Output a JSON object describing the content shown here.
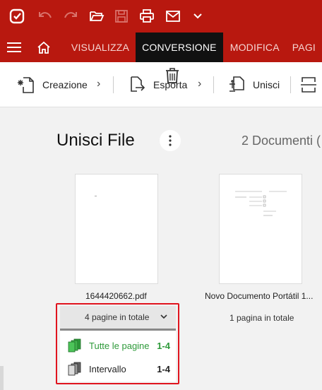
{
  "titlebar": {
    "icons": [
      "app-logo-icon",
      "undo-icon",
      "redo-icon",
      "open-folder-icon",
      "save-icon",
      "print-icon",
      "email-icon",
      "chevron-down-icon"
    ]
  },
  "menu": {
    "tabs": [
      {
        "label": "VISUALIZZA",
        "active": false
      },
      {
        "label": "CONVERSIONE",
        "active": true
      },
      {
        "label": "MODIFICA",
        "active": false
      },
      {
        "label": "PAGI",
        "active": false
      }
    ]
  },
  "toolbar": {
    "creazione": "Creazione",
    "esporta": "Esporta",
    "unisci": "Unisci"
  },
  "main": {
    "title": "Unisci File",
    "doc_count": "2 Documenti (",
    "files": [
      {
        "name": "1644420662.pdf",
        "pages": "4 pagine in totale"
      },
      {
        "name": "Novo Documento Portátil 1...",
        "pages": "1 pagina in totale"
      }
    ],
    "dropdown": {
      "selected": "4 pagine in totale",
      "options": [
        {
          "label": "Tutte le pagine",
          "range": "1-4",
          "color": "#2e9a3a"
        },
        {
          "label": "Intervallo",
          "range": "1-4",
          "color": "#222222"
        }
      ]
    }
  },
  "colors": {
    "brand": "#b8180f",
    "highlight": "#e0141e"
  }
}
